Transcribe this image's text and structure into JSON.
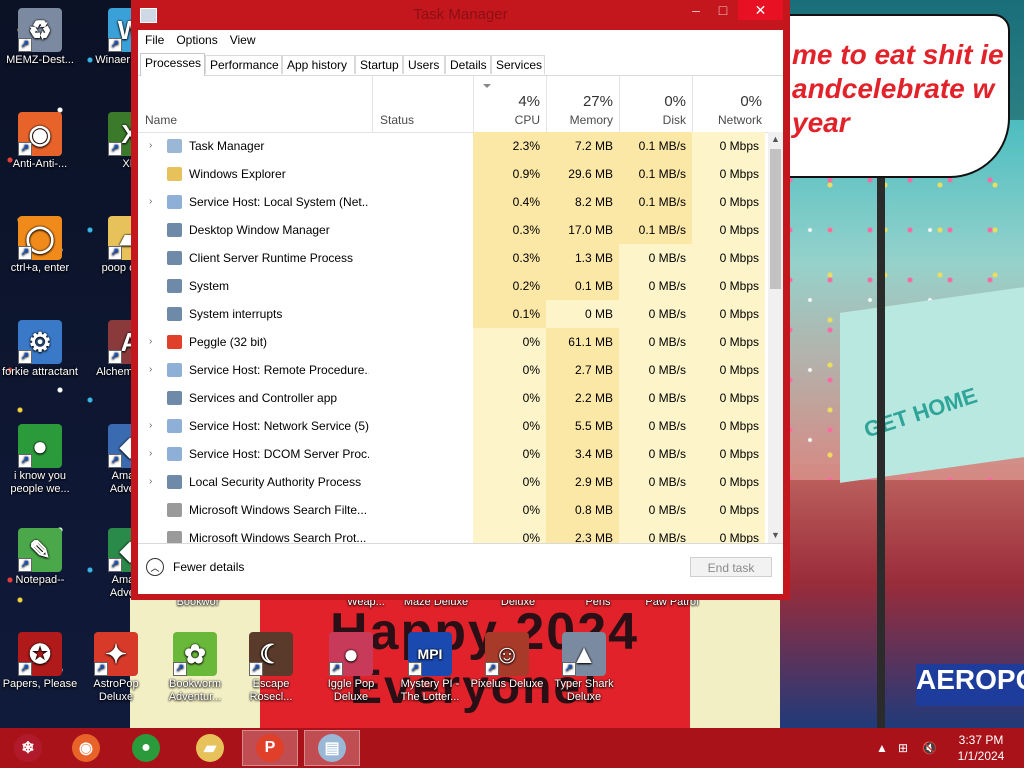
{
  "desktop": {
    "speech_text": "me to eat shit ie andcelebrate w year",
    "billboard_text": "GET HOME",
    "banner_line1": "Happy 2024",
    "banner_line2": "Everyone!",
    "sign_text": "AEROPO",
    "icons": [
      {
        "label": "MEMZ-Dest...",
        "icon": "recycle-bin-icon",
        "color": "#7b8aa0",
        "glyph": "♻"
      },
      {
        "label": "Winaer Tweak",
        "icon": "winaero-tweaker-icon",
        "color": "#3aa0d8",
        "glyph": "W"
      },
      {
        "label": "Anti-Anti-...",
        "icon": "firefox-icon",
        "color": "#e8632a",
        "glyph": "◉"
      },
      {
        "label": "XD",
        "icon": "xd-icon",
        "color": "#3a7a2a",
        "glyph": "X"
      },
      {
        "label": "ctrl+a, enter",
        "icon": "orange-ring-icon",
        "color": "#f08a1a",
        "glyph": "◯"
      },
      {
        "label": "poop cr shit",
        "icon": "folder-icon",
        "color": "#e7c15a",
        "glyph": "▰"
      },
      {
        "label": "forkie attractant",
        "icon": "control-panel-icon",
        "color": "#3a78c8",
        "glyph": "⚙"
      },
      {
        "label": "Alchem Delux",
        "icon": "alchemy-icon",
        "color": "#8a3a3a",
        "glyph": "A"
      },
      {
        "label": "i know you people we...",
        "icon": "chrome-icon",
        "color": "#2a9a3a",
        "glyph": "●"
      },
      {
        "label": "Amazin Adventu",
        "icon": "amazing-adventures-icon",
        "color": "#3a6ab0",
        "glyph": "◆"
      },
      {
        "label": "Notepad--",
        "icon": "notepad-icon",
        "color": "#4aa84a",
        "glyph": "✎"
      },
      {
        "label": "Amazin Adventu",
        "icon": "amazing-adventures-2-icon",
        "color": "#2a8a4a",
        "glyph": "◆"
      },
      {
        "label": "Papers, Please",
        "icon": "papers-please-icon",
        "color": "#b01a1a",
        "glyph": "✪"
      },
      {
        "label": "AstroPop Deluxe",
        "icon": "astropop-icon",
        "color": "#d83a2a",
        "glyph": "✦"
      },
      {
        "label": "Bookworm Adventur...",
        "icon": "bookworm-icon",
        "color": "#6ab83a",
        "glyph": "✿"
      },
      {
        "label": "Escape Rosecl...",
        "icon": "escape-rosecliff-icon",
        "color": "#5a3a2a",
        "glyph": "☾"
      },
      {
        "label": "Iggle Pop Deluxe",
        "icon": "iggle-pop-icon",
        "color": "#c83a5a",
        "glyph": "●"
      },
      {
        "label": "Mystery PI - The Lotter...",
        "icon": "mystery-pi-icon",
        "color": "#1a4ab0",
        "glyph": "MPI"
      },
      {
        "label": "Pixelus Deluxe",
        "icon": "pixelus-icon",
        "color": "#a83a2a",
        "glyph": "☺"
      },
      {
        "label": "Typer Shark Deluxe",
        "icon": "typer-shark-icon",
        "color": "#7a8aa0",
        "glyph": "▲"
      }
    ],
    "partial_labels": [
      "Bookwor",
      "Weap...",
      "Maze Deluxe",
      "Deluxe",
      "Peris",
      "Paw Patrol"
    ]
  },
  "task_manager": {
    "title": "Task Manager",
    "menu": [
      "File",
      "Options",
      "View"
    ],
    "tabs": [
      "Processes",
      "Performance",
      "App history",
      "Startup",
      "Users",
      "Details",
      "Services"
    ],
    "active_tab": "Processes",
    "columns": {
      "name": "Name",
      "status": "Status",
      "cpu": {
        "pct": "4%",
        "label": "CPU"
      },
      "memory": {
        "pct": "27%",
        "label": "Memory"
      },
      "disk": {
        "pct": "0%",
        "label": "Disk"
      },
      "network": {
        "pct": "0%",
        "label": "Network"
      }
    },
    "processes": [
      {
        "name": "Task Manager",
        "expandable": true,
        "icon": "task-manager-icon",
        "icon_color": "#9bb7d6",
        "cpu": "2.3%",
        "memory": "7.2 MB",
        "disk": "0.1 MB/s",
        "network": "0 Mbps"
      },
      {
        "name": "Windows Explorer",
        "expandable": false,
        "icon": "folder-icon",
        "icon_color": "#e7c15a",
        "cpu": "0.9%",
        "memory": "29.6 MB",
        "disk": "0.1 MB/s",
        "network": "0 Mbps"
      },
      {
        "name": "Service Host: Local System (Net...",
        "expandable": true,
        "icon": "gear-icon",
        "icon_color": "#8fb0d6",
        "cpu": "0.4%",
        "memory": "8.2 MB",
        "disk": "0.1 MB/s",
        "network": "0 Mbps"
      },
      {
        "name": "Desktop Window Manager",
        "expandable": false,
        "icon": "window-icon",
        "icon_color": "#6f8aa8",
        "cpu": "0.3%",
        "memory": "17.0 MB",
        "disk": "0.1 MB/s",
        "network": "0 Mbps"
      },
      {
        "name": "Client Server Runtime Process",
        "expandable": false,
        "icon": "window-icon",
        "icon_color": "#6f8aa8",
        "cpu": "0.3%",
        "memory": "1.3 MB",
        "disk": "0 MB/s",
        "network": "0 Mbps"
      },
      {
        "name": "System",
        "expandable": false,
        "icon": "window-icon",
        "icon_color": "#6f8aa8",
        "cpu": "0.2%",
        "memory": "0.1 MB",
        "disk": "0 MB/s",
        "network": "0 Mbps"
      },
      {
        "name": "System interrupts",
        "expandable": false,
        "icon": "window-icon",
        "icon_color": "#6f8aa8",
        "cpu": "0.1%",
        "memory": "0 MB",
        "disk": "0 MB/s",
        "network": "0 Mbps"
      },
      {
        "name": "Peggle (32 bit)",
        "expandable": true,
        "icon": "peggle-icon",
        "icon_color": "#e0402a",
        "cpu": "0%",
        "memory": "61.1 MB",
        "disk": "0 MB/s",
        "network": "0 Mbps"
      },
      {
        "name": "Service Host: Remote Procedure...",
        "expandable": true,
        "icon": "gear-icon",
        "icon_color": "#8fb0d6",
        "cpu": "0%",
        "memory": "2.7 MB",
        "disk": "0 MB/s",
        "network": "0 Mbps"
      },
      {
        "name": "Services and Controller app",
        "expandable": false,
        "icon": "window-icon",
        "icon_color": "#6f8aa8",
        "cpu": "0%",
        "memory": "2.2 MB",
        "disk": "0 MB/s",
        "network": "0 Mbps"
      },
      {
        "name": "Service Host: Network Service (5)",
        "expandable": true,
        "icon": "gear-icon",
        "icon_color": "#8fb0d6",
        "cpu": "0%",
        "memory": "5.5 MB",
        "disk": "0 MB/s",
        "network": "0 Mbps"
      },
      {
        "name": "Service Host: DCOM Server Proc...",
        "expandable": true,
        "icon": "gear-icon",
        "icon_color": "#8fb0d6",
        "cpu": "0%",
        "memory": "3.4 MB",
        "disk": "0 MB/s",
        "network": "0 Mbps"
      },
      {
        "name": "Local Security Authority Process",
        "expandable": true,
        "icon": "window-icon",
        "icon_color": "#6f8aa8",
        "cpu": "0%",
        "memory": "2.9 MB",
        "disk": "0 MB/s",
        "network": "0 Mbps"
      },
      {
        "name": "Microsoft Windows Search Filte...",
        "expandable": false,
        "icon": "search-user-icon",
        "icon_color": "#9a9a9a",
        "cpu": "0%",
        "memory": "0.8 MB",
        "disk": "0 MB/s",
        "network": "0 Mbps"
      },
      {
        "name": "Microsoft Windows Search Prot...",
        "expandable": false,
        "icon": "search-user-icon",
        "icon_color": "#9a9a9a",
        "cpu": "0%",
        "memory": "2.3 MB",
        "disk": "0 MB/s",
        "network": "0 Mbps"
      }
    ],
    "footer": {
      "fewer_details": "Fewer details",
      "end_task": "End task"
    }
  },
  "taskbar": {
    "items": [
      {
        "icon": "bauble-start-icon",
        "color": "#b01a2a",
        "glyph": "❄",
        "active": false
      },
      {
        "icon": "firefox-icon",
        "color": "#e8632a",
        "glyph": "◉",
        "active": false
      },
      {
        "icon": "chrome-icon",
        "color": "#2a9a3a",
        "glyph": "●",
        "active": false
      },
      {
        "icon": "file-explorer-icon",
        "color": "#e7c15a",
        "glyph": "▰",
        "active": false
      },
      {
        "icon": "peggle-icon",
        "color": "#e0402a",
        "glyph": "P",
        "active": true
      },
      {
        "icon": "task-manager-icon",
        "color": "#9bb7d6",
        "glyph": "▤",
        "active": true
      }
    ],
    "time": "3:37 PM",
    "date": "1/1/2024"
  },
  "colors": {
    "titlebar": "#c4161d",
    "taskbar": "#aa1219",
    "cpu_heat_high": "#fbe7a6",
    "cpu_heat_low": "#fdf4c9"
  }
}
